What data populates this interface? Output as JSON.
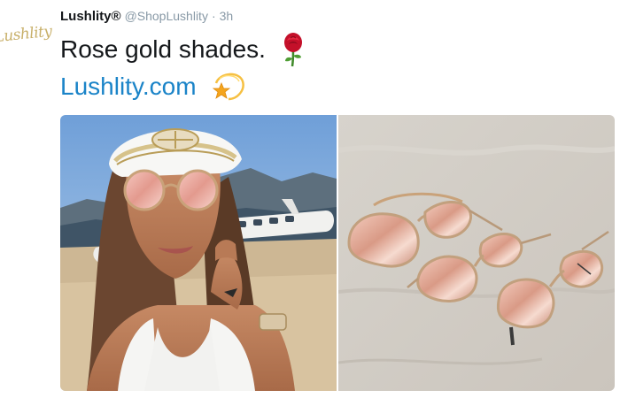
{
  "tweet": {
    "display_name": "Lushlity®",
    "handle": "@ShopLushlity",
    "separator": "·",
    "time": "3h",
    "text": "Rose gold shades.",
    "link": "Lushlity.com",
    "avatar_text": "Lushlity"
  },
  "icons": {
    "rose": "rose-emoji-icon",
    "star": "dizzy-star-emoji-icon"
  },
  "colors": {
    "link": "#1b84c8",
    "meta": "#8899a6",
    "brand_gold": "#c8b06a"
  },
  "media": {
    "photos": [
      {
        "name": "woman-with-cap-and-sunglasses-photo"
      },
      {
        "name": "three-rose-gold-sunglasses-on-sand-photo"
      }
    ]
  }
}
